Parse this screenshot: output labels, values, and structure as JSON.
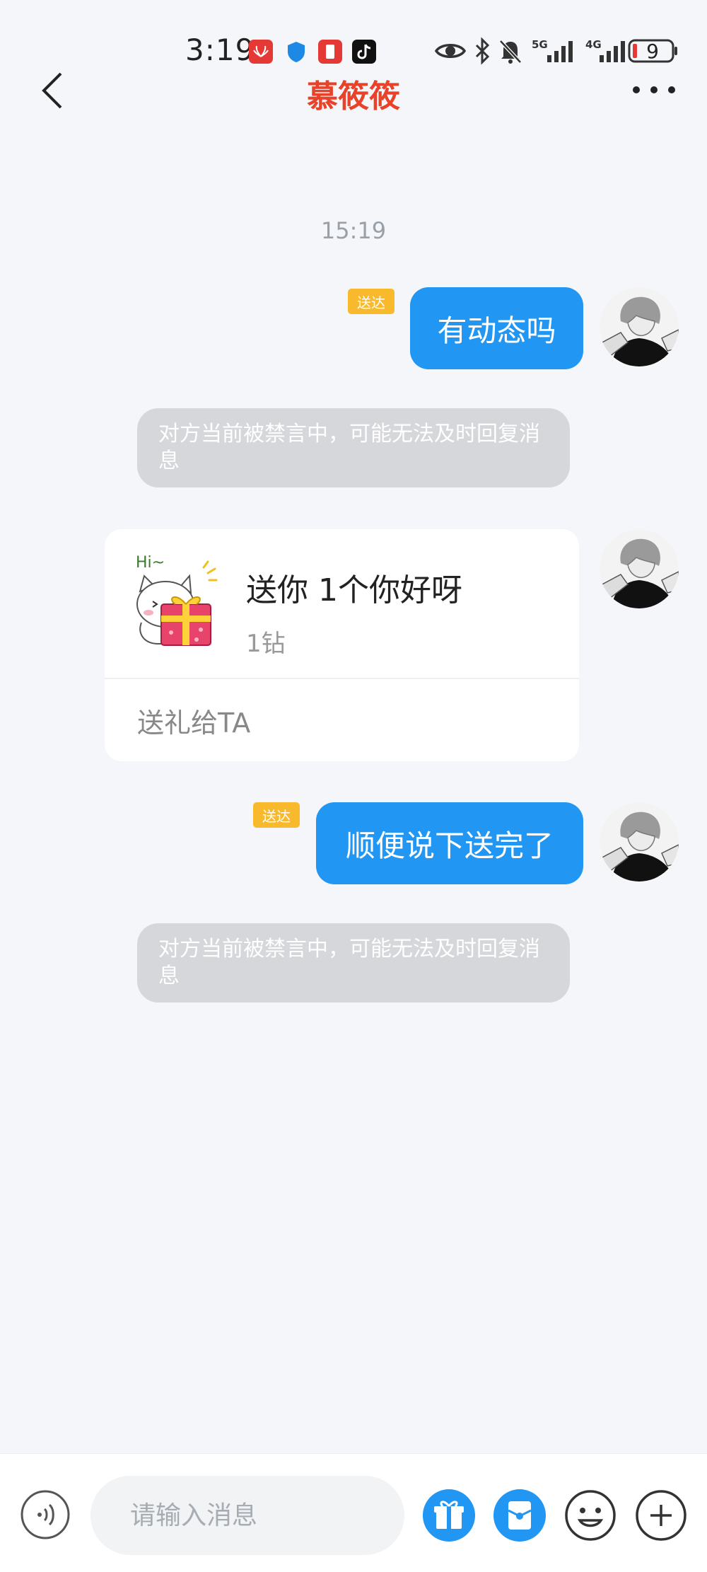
{
  "status_bar": {
    "time": "3:19",
    "network_5g": "5G",
    "network_4g": "4G",
    "battery": "9"
  },
  "header": {
    "title": "慕筱筱"
  },
  "chat": {
    "timestamp": "15:19",
    "messages": [
      {
        "text": "有动态吗",
        "status": "送达"
      },
      {
        "notice": "对方当前被禁言中，可能无法及时回复消息"
      },
      {
        "gift": {
          "title": "送你 1个你好呀",
          "price": "1钻",
          "action": "送礼给TA",
          "image_text": "Hi~"
        }
      },
      {
        "text": "顺便说下送完了",
        "status": "送达"
      },
      {
        "notice": "对方当前被禁言中，可能无法及时回复消息"
      }
    ]
  },
  "input_bar": {
    "placeholder": "请输入消息"
  },
  "colors": {
    "accent": "#2196f3",
    "title": "#e8432a",
    "delivered_badge": "#f9b92c",
    "notice_bg": "#d5d7da"
  }
}
